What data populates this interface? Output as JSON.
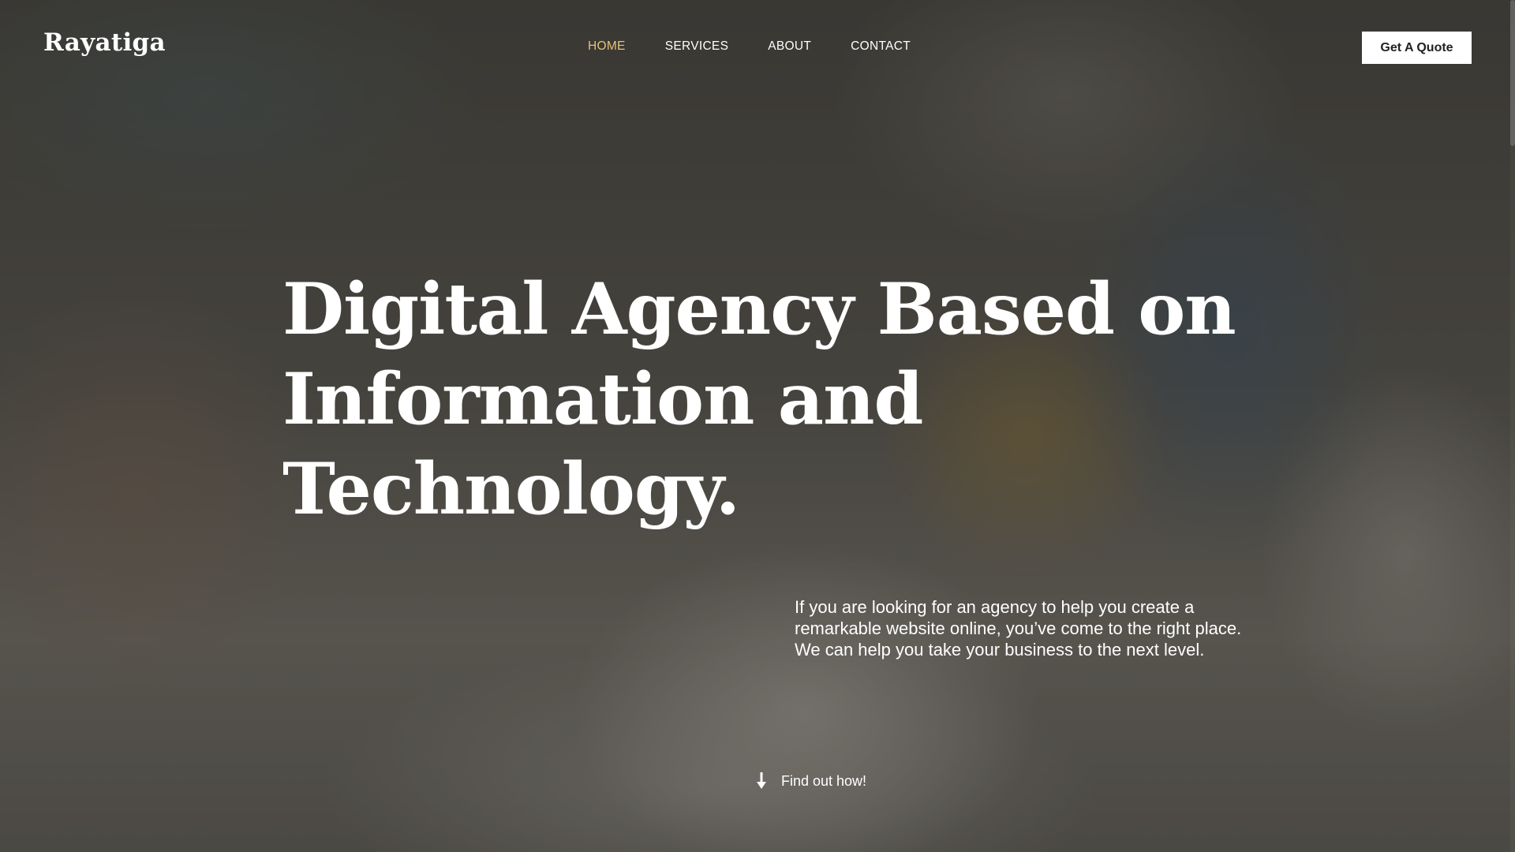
{
  "header": {
    "logo": "Rayatiga",
    "nav": [
      {
        "label": "HOME",
        "active": true
      },
      {
        "label": "SERVICES",
        "active": false
      },
      {
        "label": "ABOUT",
        "active": false
      },
      {
        "label": "CONTACT",
        "active": false
      }
    ],
    "cta_label": "Get A Quote"
  },
  "hero": {
    "title_lines": [
      "Digital Agency Based on",
      "Information and",
      "Technology."
    ],
    "description": "If you are looking for an agency to help you create a remarkable website online, you’ve come to the right place. We can help you take your business to the next level.",
    "find_out_label": "Find out how!",
    "find_out_icon": "arrow-down-icon"
  },
  "colors": {
    "accent": "#e5c27a",
    "text": "#ffffff",
    "button_bg": "#ffffff",
    "button_text": "#222222"
  }
}
